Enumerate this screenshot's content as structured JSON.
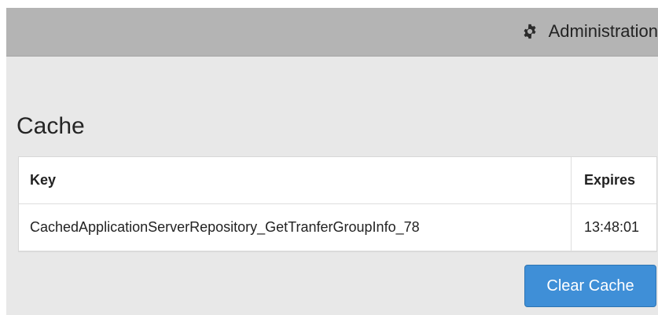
{
  "header": {
    "admin_label": "Administration",
    "admin_icon": "gear-icon"
  },
  "main": {
    "title": "Cache",
    "table": {
      "columns": [
        "Key",
        "Expires"
      ],
      "rows": [
        {
          "key": "CachedApplicationServerRepository_GetTranferGroupInfo_78",
          "expires": "13:48:01"
        }
      ]
    },
    "clear_button_label": "Clear Cache"
  },
  "colors": {
    "header_bg": "#b4b4b4",
    "page_bg": "#e8e8e8",
    "button_bg": "#3f8fd7",
    "button_text": "#ffffff"
  }
}
